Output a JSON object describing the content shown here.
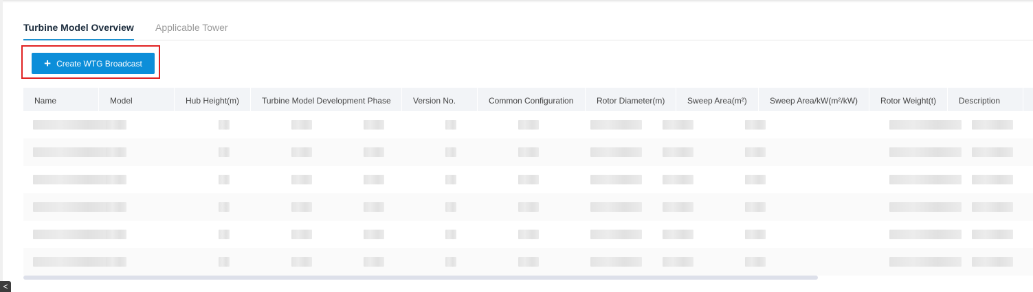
{
  "tabs": [
    {
      "label": "Turbine Model Overview",
      "active": true
    },
    {
      "label": "Applicable Tower",
      "active": false
    }
  ],
  "toolbar": {
    "create_label": "Create WTG Broadcast",
    "create_icon": "plus-icon"
  },
  "table": {
    "columns": [
      "Name",
      "Model",
      "Hub Height(m)",
      "Turbine Model Development Phase",
      "Version No.",
      "Common Configuration",
      "Rotor Diameter(m)",
      "Sweep Area(m²)",
      "Sweep Area/kW(m²/kW)",
      "Rotor Weight(t)",
      "Description"
    ],
    "row_count": 6,
    "cells_obscured": true
  },
  "sidebar": {
    "collapse_icon": "chevron-left-icon",
    "collapse_glyph": "<"
  },
  "colors": {
    "accent": "#0c8ed9",
    "highlight": "#e02020",
    "header_bg": "#f2f4f7"
  }
}
